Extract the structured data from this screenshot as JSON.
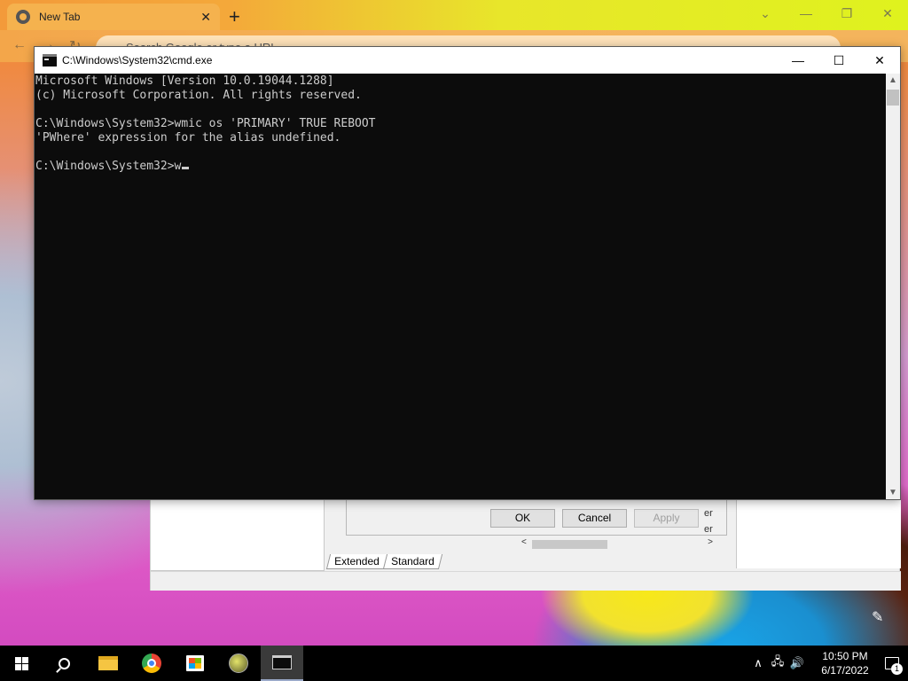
{
  "chrome": {
    "tab_title": "New Tab",
    "tab_close": "✕",
    "new_tab": "+",
    "omnibox_placeholder": "Search Google or type a URL",
    "caption": {
      "dropdown": "⌄",
      "minimize": "—",
      "restore": "❐",
      "close": "✕"
    },
    "nav": {
      "back": "←",
      "forward": "→",
      "reload": "↻"
    }
  },
  "cmd": {
    "title": "C:\\Windows\\System32\\cmd.exe",
    "caption": {
      "minimize": "—",
      "maximize": "☐",
      "close": "✕"
    },
    "lines": [
      "Microsoft Windows [Version 10.0.19044.1288]",
      "(c) Microsoft Corporation. All rights reserved.",
      "",
      "C:\\Windows\\System32>wmic os 'PRIMARY' TRUE REBOOT",
      "'PWhere' expression for the alias undefined.",
      ""
    ],
    "prompt": "C:\\Windows\\System32>",
    "input": "w",
    "scroll_up": "▲",
    "scroll_down": "▼"
  },
  "dialog": {
    "ok_label": "OK",
    "cancel_label": "Cancel",
    "apply_label": "Apply",
    "side_text_1": "er",
    "side_text_2": "er",
    "tabs": [
      "Extended",
      "Standard"
    ],
    "scroll_left": "<",
    "scroll_right": ">"
  },
  "taskbar": {
    "time": "10:50 PM",
    "date": "6/17/2022",
    "notification_count": "1",
    "tray": {
      "chevron": "∧",
      "network": "🖧",
      "volume": "🔊"
    }
  },
  "colors": {
    "console_bg": "#0c0c0c",
    "console_fg": "#cccccc",
    "taskbar_bg": "#000000"
  }
}
